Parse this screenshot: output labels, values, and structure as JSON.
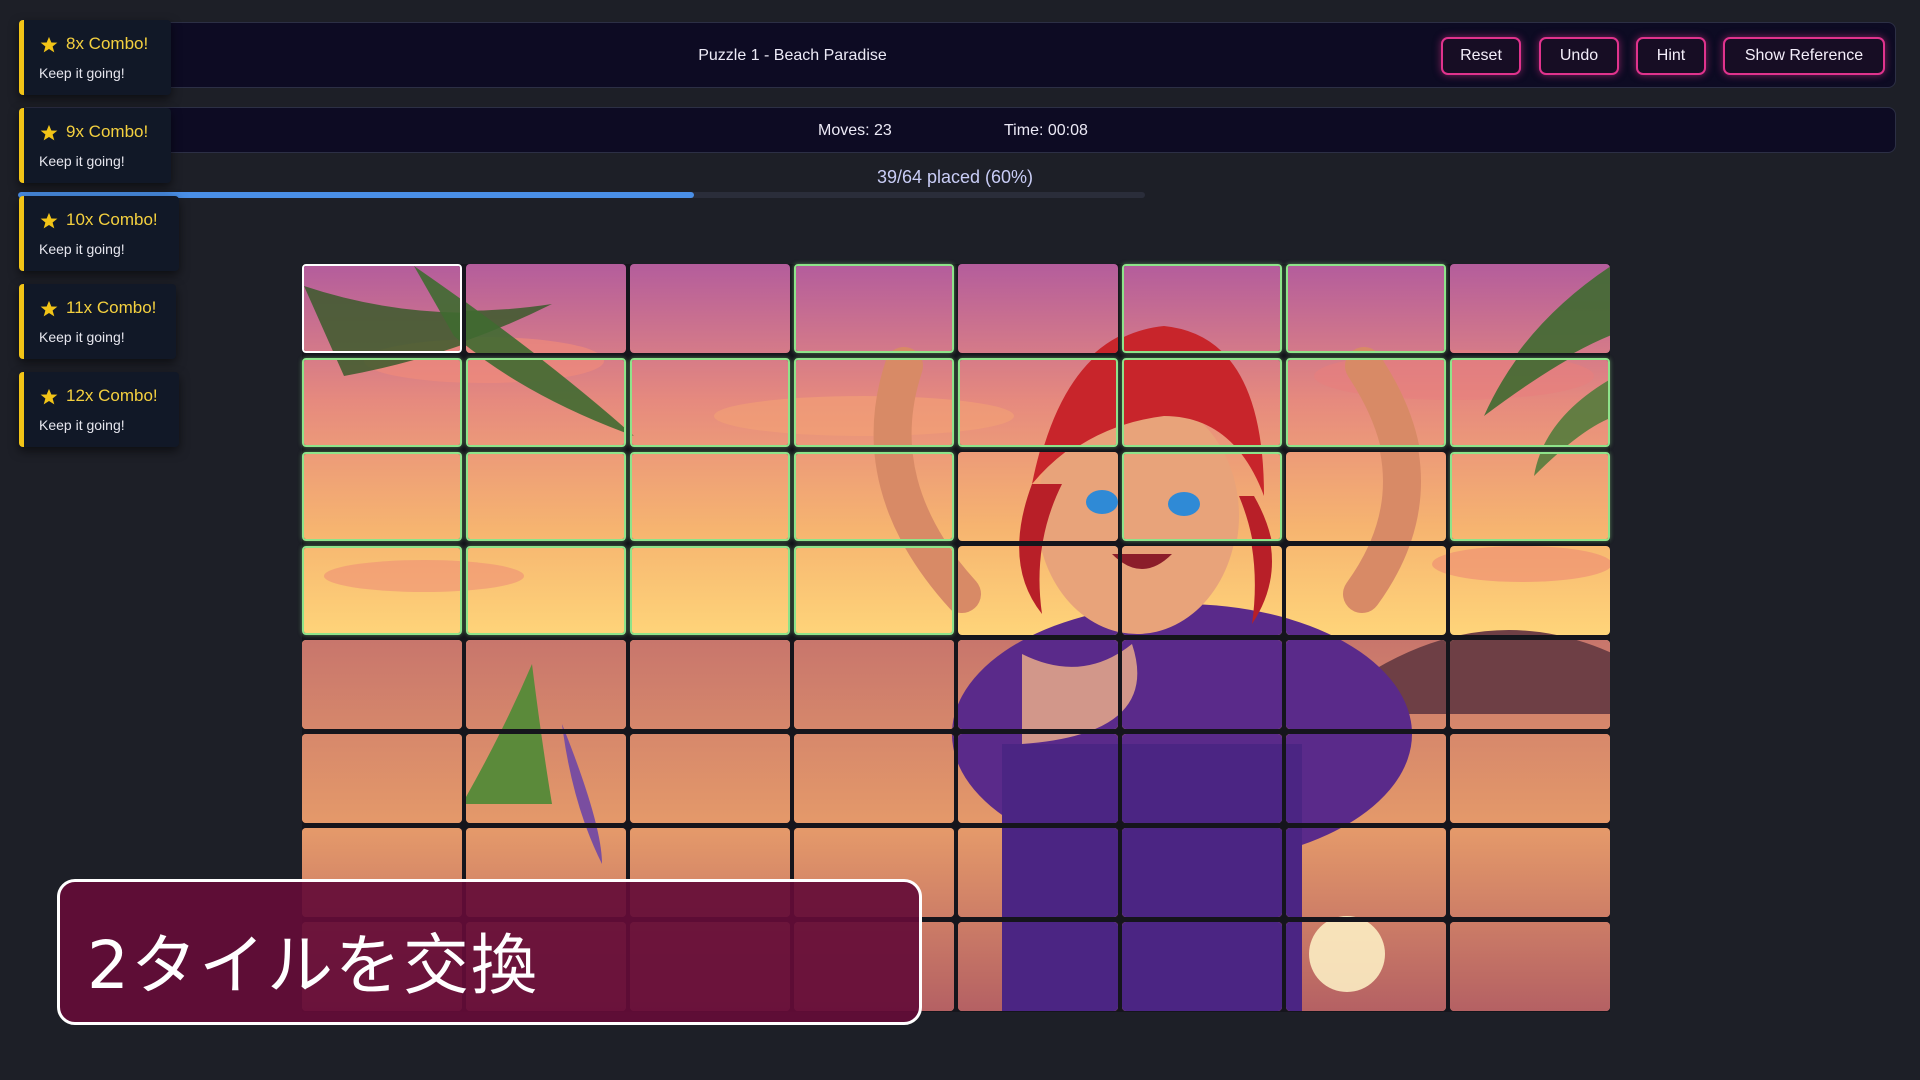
{
  "header": {
    "title": "Puzzle 1 - Beach Paradise",
    "buttons": {
      "reset": "Reset",
      "undo": "Undo",
      "hint": "Hint",
      "show_reference": "Show Reference"
    }
  },
  "stats": {
    "moves": "Moves: 23",
    "time": "Time: 00:08"
  },
  "progress": {
    "text": "39/64 placed (60%)",
    "placed": 39,
    "total": 64,
    "fraction": 0.6
  },
  "combo_toasts": [
    {
      "title": "8x Combo!",
      "subtitle": "Keep it going!"
    },
    {
      "title": "9x Combo!",
      "subtitle": "Keep it going!"
    },
    {
      "title": "10x Combo!",
      "subtitle": "Keep it going!"
    },
    {
      "title": "11x Combo!",
      "subtitle": "Keep it going!"
    },
    {
      "title": "12x Combo!",
      "subtitle": "Keep it going!"
    }
  ],
  "action_toast": {
    "text": "2タイルを交換"
  },
  "board": {
    "rows": 8,
    "cols": 8,
    "selected_tile": {
      "row": 0,
      "col": 0
    },
    "correct_tiles": [
      [
        0,
        0
      ],
      [
        0,
        3
      ],
      [
        0,
        5
      ],
      [
        0,
        6
      ],
      [
        1,
        0
      ],
      [
        1,
        1
      ],
      [
        1,
        2
      ],
      [
        1,
        3
      ],
      [
        1,
        4
      ],
      [
        1,
        5
      ],
      [
        1,
        6
      ],
      [
        1,
        7
      ],
      [
        2,
        0
      ],
      [
        2,
        1
      ],
      [
        2,
        2
      ],
      [
        2,
        3
      ],
      [
        2,
        5
      ],
      [
        2,
        7
      ],
      [
        3,
        0
      ],
      [
        3,
        1
      ],
      [
        3,
        2
      ],
      [
        3,
        3
      ]
    ]
  },
  "colors": {
    "accent_button": "#e0338d",
    "combo_accent": "#f2c417",
    "correct_tile_border": "#8ee38a",
    "progress_fill": "#4a8fe7",
    "action_toast_bg": "#640c37"
  }
}
